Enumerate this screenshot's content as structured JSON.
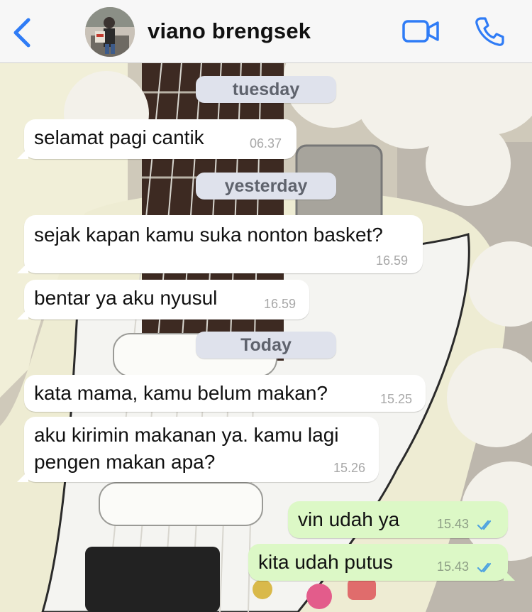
{
  "header": {
    "contact_name": "viano brengsek",
    "back_icon": "chevron-left-icon",
    "video_icon": "video-camera-icon",
    "call_icon": "phone-icon",
    "accent_color": "#2f7cf6"
  },
  "chat": {
    "date_tuesday": "tuesday",
    "date_yesterday": "yesterday",
    "date_today": "Today",
    "messages": [
      {
        "text": "selamat pagi cantik",
        "time": "06.37",
        "direction": "incoming"
      },
      {
        "text": "sejak kapan kamu suka nonton basket?",
        "time": "16.59",
        "direction": "incoming"
      },
      {
        "text": "bentar ya aku nyusul",
        "time": "16.59",
        "direction": "incoming"
      },
      {
        "text": "kata mama, kamu belum makan?",
        "time": "15.25",
        "direction": "incoming"
      },
      {
        "line1": "aku kirimin makanan ya. kamu lagi",
        "line2": "pengen makan apa?",
        "time": "15.26",
        "direction": "incoming"
      },
      {
        "text": "vin udah ya",
        "time": "15.43",
        "direction": "outgoing",
        "status": "read"
      },
      {
        "text": "kita udah putus",
        "time": "15.43",
        "direction": "outgoing",
        "status": "read"
      }
    ]
  },
  "colors": {
    "outgoing_bubble": "#dcf8c6",
    "incoming_bubble": "#ffffff",
    "date_pill": "#dfe2ec",
    "read_ticks": "#4fa3e0"
  }
}
